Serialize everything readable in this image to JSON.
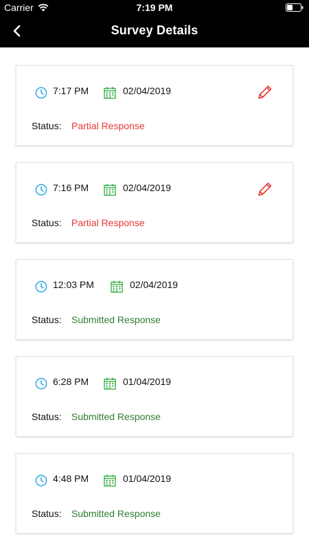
{
  "status_bar": {
    "carrier": "Carrier",
    "time": "7:19 PM"
  },
  "nav": {
    "title": "Survey Details"
  },
  "colors": {
    "clock_icon": "#29a8e0",
    "calendar_icon": "#3db04b",
    "partial": "#e53935",
    "submitted": "#2e7d32",
    "edit_icon": "#e53935"
  },
  "status_label": "Status:",
  "surveys": [
    {
      "time": "7:17 PM",
      "date": "02/04/2019",
      "status": "Partial Response",
      "editable": true
    },
    {
      "time": "7:16 PM",
      "date": "02/04/2019",
      "status": "Partial Response",
      "editable": true
    },
    {
      "time": "12:03 PM",
      "date": "02/04/2019",
      "status": "Submitted Response",
      "editable": false
    },
    {
      "time": "6:28 PM",
      "date": "01/04/2019",
      "status": "Submitted Response",
      "editable": false
    },
    {
      "time": "4:48 PM",
      "date": "01/04/2019",
      "status": "Submitted Response",
      "editable": false
    }
  ]
}
